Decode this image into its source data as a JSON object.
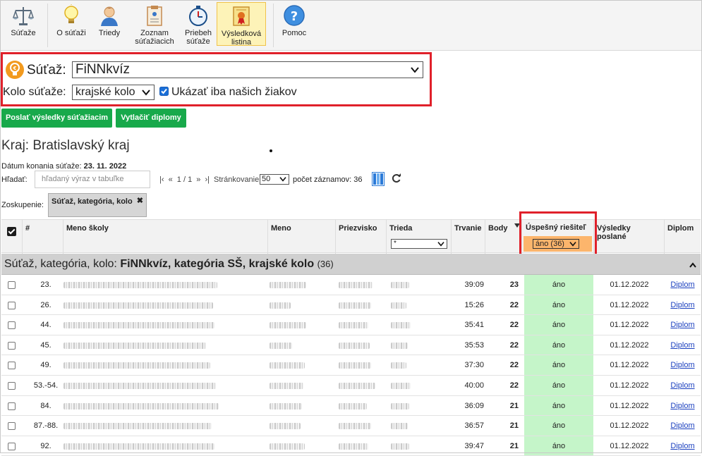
{
  "toolbar": [
    {
      "label": "Súťaže",
      "icon": "scales-icon"
    },
    {
      "label": "O súťaži",
      "icon": "lightbulb-icon"
    },
    {
      "label": "Triedy",
      "icon": "person-icon"
    },
    {
      "label": "Zoznam súťažiacich",
      "icon": "clipboard-icon"
    },
    {
      "label": "Priebeh súťaže",
      "icon": "stopwatch-icon"
    },
    {
      "label": "Výsledková listina",
      "icon": "certificate-icon"
    },
    {
      "label": "Pomoc",
      "icon": "help-icon"
    }
  ],
  "selection": {
    "competition_label": "Súťaž:",
    "competition_value": "FiNNkvíz",
    "round_label": "Kolo súťaže:",
    "round_value": "krajské kolo",
    "only_ours_label": "Ukázať iba našich žiakov"
  },
  "buttons": {
    "send_results": "Poslať výsledky súťažiacim",
    "print_diplomas": "Vytlačiť diplomy"
  },
  "region_title": "Kraj: Bratislavský kraj",
  "date": {
    "label": "Dátum konania súťaže:",
    "value": "23. 11. 2022"
  },
  "search": {
    "label": "Hľadať:",
    "placeholder": "hľadaný výraz v tabuľke"
  },
  "pager": {
    "first": "|‹",
    "prev": "«",
    "page": "1 / 1",
    "next": "»",
    "last": "›|",
    "paging_label": "Stránkovanie:",
    "page_size": "50",
    "count_label": "počet záznamov: 36"
  },
  "grouping": {
    "label": "Zoskupenie:",
    "chip": "Súťaž, kategória, kolo",
    "chip_close": "✖"
  },
  "columns": {
    "num": "#",
    "school": "Meno školy",
    "name": "Meno",
    "surname": "Priezvisko",
    "class": "Trieda",
    "class_filter": "*",
    "duration": "Trvanie",
    "points": "Body",
    "success": "Úspešný riešiteľ",
    "success_filter": "áno (36)",
    "results_sent": "Výsledky poslané",
    "diploma": "Diplom"
  },
  "group_row": {
    "prefix": "Súťaž, kategória, kolo:",
    "value": "FiNNkvíz, kategória SŠ, krajské kolo",
    "count": "(36)"
  },
  "rows": [
    {
      "rank": "23.",
      "duration": "39:09",
      "points": "23",
      "success": "áno",
      "sent": "01.12.2022",
      "diploma": "Diplom"
    },
    {
      "rank": "26.",
      "duration": "15:26",
      "points": "22",
      "success": "áno",
      "sent": "01.12.2022",
      "diploma": "Diplom"
    },
    {
      "rank": "44.",
      "duration": "35:41",
      "points": "22",
      "success": "áno",
      "sent": "01.12.2022",
      "diploma": "Diplom"
    },
    {
      "rank": "45.",
      "duration": "35:53",
      "points": "22",
      "success": "áno",
      "sent": "01.12.2022",
      "diploma": "Diplom"
    },
    {
      "rank": "49.",
      "duration": "37:30",
      "points": "22",
      "success": "áno",
      "sent": "01.12.2022",
      "diploma": "Diplom"
    },
    {
      "rank": "53.-54.",
      "duration": "40:00",
      "points": "22",
      "success": "áno",
      "sent": "01.12.2022",
      "diploma": "Diplom"
    },
    {
      "rank": "84.",
      "duration": "36:09",
      "points": "21",
      "success": "áno",
      "sent": "01.12.2022",
      "diploma": "Diplom"
    },
    {
      "rank": "87.-88.",
      "duration": "36:57",
      "points": "21",
      "success": "áno",
      "sent": "01.12.2022",
      "diploma": "Diplom"
    },
    {
      "rank": "92.",
      "duration": "39:47",
      "points": "21",
      "success": "áno",
      "sent": "01.12.2022",
      "diploma": "Diplom"
    }
  ],
  "colors": {
    "accent_red": "#e0202a",
    "green_button": "#18a94b",
    "success_green": "#c5f5c9",
    "filter_orange": "#fcb56c",
    "link": "#1a3fbf"
  }
}
